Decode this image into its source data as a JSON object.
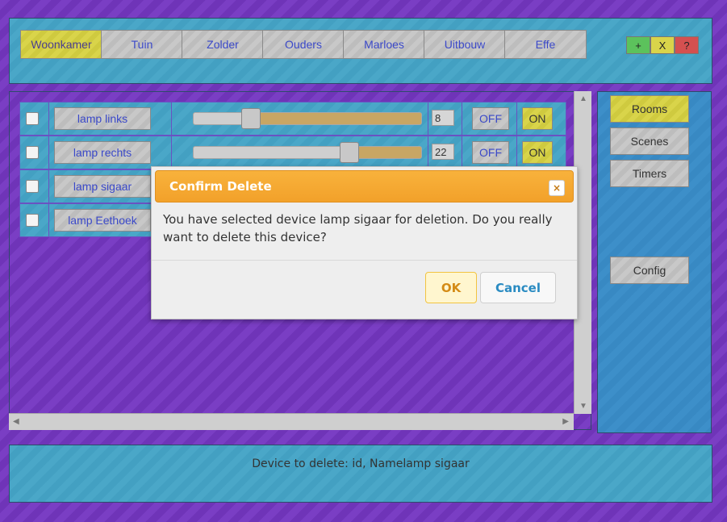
{
  "tabs": [
    {
      "label": "Woonkamer",
      "active": true
    },
    {
      "label": "Tuin"
    },
    {
      "label": "Zolder"
    },
    {
      "label": "Ouders"
    },
    {
      "label": "Marloes"
    },
    {
      "label": "Uitbouw"
    },
    {
      "label": "Effe"
    }
  ],
  "top_buttons": {
    "add": "+",
    "close": "X",
    "help": "?"
  },
  "devices": [
    {
      "name": "lamp links",
      "level": 8,
      "off_label": "OFF",
      "on_label": "ON"
    },
    {
      "name": "lamp rechts",
      "level": 22,
      "off_label": "OFF",
      "on_label": "ON"
    },
    {
      "name": "lamp sigaar"
    },
    {
      "name": "lamp Eethoek"
    }
  ],
  "sidebar": {
    "rooms": "Rooms",
    "scenes": "Scenes",
    "timers": "Timers",
    "config": "Config"
  },
  "status": {
    "text": "Device to delete: id, Namelamp sigaar"
  },
  "dialog": {
    "title": "Confirm Delete",
    "close_symbol": "×",
    "message": "You have selected device lamp sigaar for deletion. Do you really want to delete this device?",
    "ok_label": "OK",
    "cancel_label": "Cancel"
  },
  "colors": {
    "background": "#7a3ec4",
    "panel_teal": "#4aa7c8",
    "panel_blue": "#3d8fc9",
    "accent_yellow": "#d9d44a",
    "dialog_header": "#f2a12a"
  }
}
